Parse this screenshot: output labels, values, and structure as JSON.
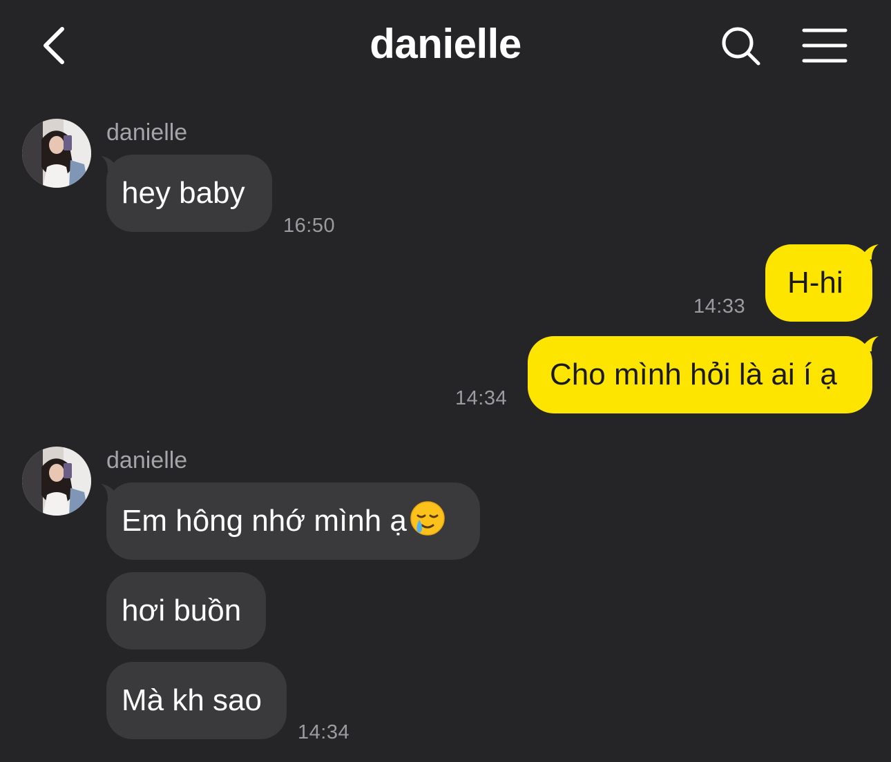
{
  "header": {
    "title": "danielle"
  },
  "messages": {
    "group1": {
      "sender": "danielle",
      "bubbles": [
        {
          "text": "hey baby",
          "time": "16:50"
        }
      ]
    },
    "outgoing": [
      {
        "text": "H-hi",
        "time": "14:33"
      },
      {
        "text": "Cho mình hỏi là ai í ạ",
        "time": "14:34"
      }
    ],
    "group2": {
      "sender": "danielle",
      "bubbles": [
        {
          "text": "Em hông nhớ mình ạ",
          "emoji": "crying-smile-emoji"
        },
        {
          "text": "hơi buồn"
        },
        {
          "text": "Mà kh sao",
          "time": "14:34"
        }
      ]
    }
  },
  "colors": {
    "background": "#252527",
    "incoming_bubble": "#3a3a3c",
    "outgoing_bubble": "#fee500",
    "timestamp": "#9c9ca0",
    "sender_name": "#a5a5a9"
  }
}
